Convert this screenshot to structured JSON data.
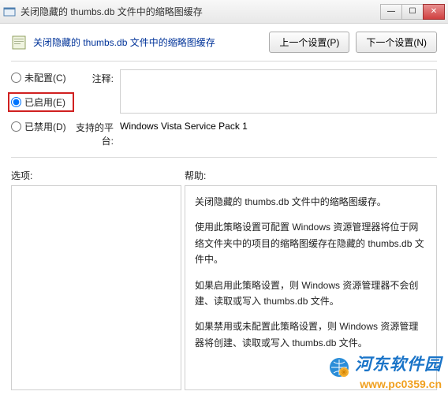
{
  "window": {
    "title": "关闭隐藏的 thumbs.db 文件中的缩略图缓存",
    "buttons": {
      "min": "—",
      "max": "☐",
      "close": "✕"
    }
  },
  "header": {
    "title": "关闭隐藏的 thumbs.db 文件中的缩略图缓存",
    "prev": "上一个设置(P)",
    "next": "下一个设置(N)"
  },
  "radios": {
    "not_configured": "未配置(C)",
    "enabled": "已启用(E)",
    "disabled": "已禁用(D)"
  },
  "fields": {
    "comment_label": "注释:",
    "platform_label": "支持的平台:",
    "platform_value": "Windows Vista Service Pack 1"
  },
  "lower": {
    "options_label": "选项:",
    "help_label": "帮助:"
  },
  "help": {
    "p1": "关闭隐藏的 thumbs.db 文件中的缩略图缓存。",
    "p2": "使用此策略设置可配置 Windows 资源管理器将位于网络文件夹中的项目的缩略图缓存在隐藏的 thumbs.db 文件中。",
    "p3": "如果启用此策略设置，则 Windows 资源管理器不会创建、读取或写入 thumbs.db 文件。",
    "p4": "如果禁用或未配置此策略设置，则 Windows 资源管理器将创建、读取或写入 thumbs.db 文件。"
  },
  "watermark": {
    "name": "河东软件园",
    "url": "www.pc0359.cn"
  }
}
